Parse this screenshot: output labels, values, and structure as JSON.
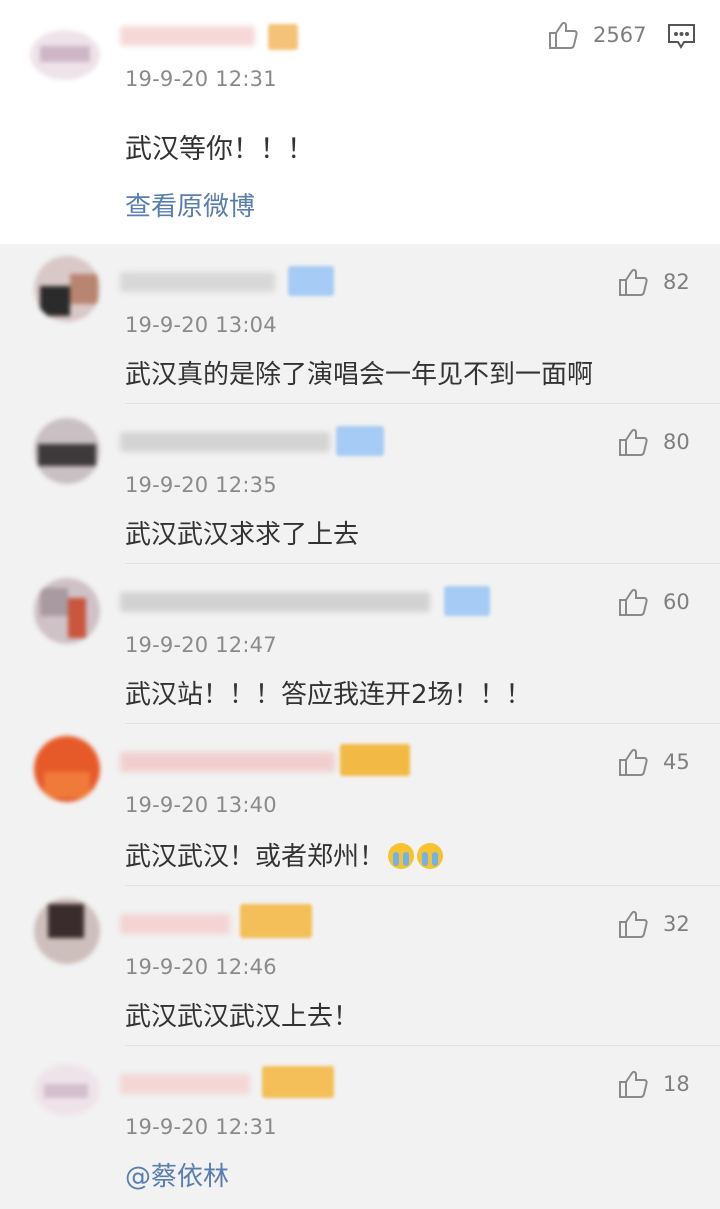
{
  "post": {
    "like_count": "2567",
    "time": "19-9-20 12:31",
    "content": "武汉等你！！！",
    "view_original": "查看原微博"
  },
  "comments": [
    {
      "time": "19-9-20 13:04",
      "content": "武汉真的是除了演唱会一年见不到一面啊",
      "likes": "82"
    },
    {
      "time": "19-9-20 12:35",
      "content": "武汉武汉求求了上去",
      "likes": "80"
    },
    {
      "time": "19-9-20 12:47",
      "content": "武汉站！！！答应我连开2场！！！",
      "likes": "60"
    },
    {
      "time": "19-9-20 13:40",
      "content": "武汉武汉！或者郑州！",
      "likes": "45",
      "emoji": "crying-face-emoji"
    },
    {
      "time": "19-9-20 12:46",
      "content": "武汉武汉武汉上去！",
      "likes": "32"
    },
    {
      "time": "19-9-20 12:31",
      "content": "@蔡依林",
      "likes": "18"
    }
  ],
  "colors": {
    "link": "#5a7db0",
    "muted": "#8a8a8a",
    "vip_badge": "#f2a93b",
    "verified_badge": "#7fb2f0"
  },
  "icons": [
    "thumbs-up-icon",
    "comment-icon"
  ]
}
